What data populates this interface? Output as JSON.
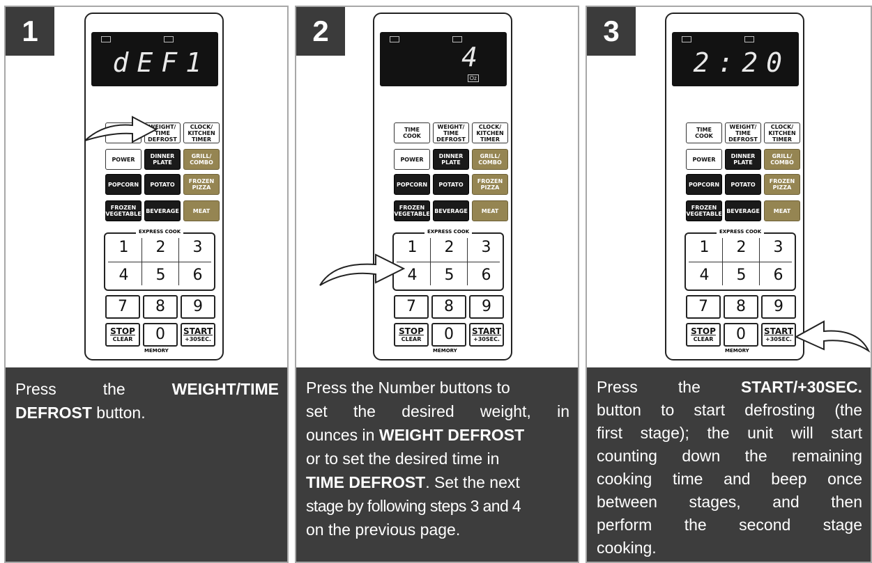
{
  "steps": [
    {
      "number": "1",
      "display": "dEF1",
      "caption": {
        "line1_pre": "Press the ",
        "line1_bold": "WEIGHT/TIME",
        "line2_bold": "DEFROST",
        "line2_post": " button."
      }
    },
    {
      "number": "2",
      "display": "4",
      "display_unit": "Oz",
      "caption": {
        "l1": "Press the Number buttons to",
        "l2": "set the desired weight, in",
        "l3_pre": "ounces in ",
        "l3_bold": "WEIGHT DEFROST",
        "l4": "or to set the desired time in",
        "l5_bold": "TIME DEFROST",
        "l5_post": ". Set the next",
        "l6": "stage by following steps 3 and 4",
        "l7": "on the previous page."
      }
    },
    {
      "number": "3",
      "display": "2:20",
      "caption": {
        "l1_pre": "Press the ",
        "l1_bold": "START/+30SEC.",
        "l2": "button to start defrosting (the",
        "l3": "first stage); the unit will start",
        "l4": "counting down the remaining",
        "l5": "cooking time and beep once",
        "l6": "between stages, and then",
        "l7": "perform the second stage",
        "l8": "cooking."
      }
    }
  ],
  "keypad": {
    "time_cook": "TIME COOK",
    "weight_time_defrost": "WEIGHT/ TIME DEFROST",
    "clock_kitchen_timer": "CLOCK/ KITCHEN TIMER",
    "power": "POWER",
    "dinner_plate": "DINNER PLATE",
    "grill_combo": "GRILL/ COMBO",
    "popcorn": "POPCORN",
    "potato": "POTATO",
    "frozen_pizza": "FROZEN PIZZA",
    "frozen_vegetable": "FROZEN VEGETABLE",
    "beverage": "BEVERAGE",
    "meat": "MEAT",
    "express_cook": "EXPRESS COOK",
    "digits": [
      "1",
      "2",
      "3",
      "4",
      "5",
      "6",
      "7",
      "8",
      "9",
      "0"
    ],
    "stop": "STOP",
    "clear": "CLEAR",
    "start": "START",
    "plus30": "+30SEC.",
    "memory": "MEMORY"
  },
  "colors": {
    "panel_bg": "#3d3d3d",
    "gold_button": "#958552",
    "dark_button": "#1a1a1a"
  }
}
